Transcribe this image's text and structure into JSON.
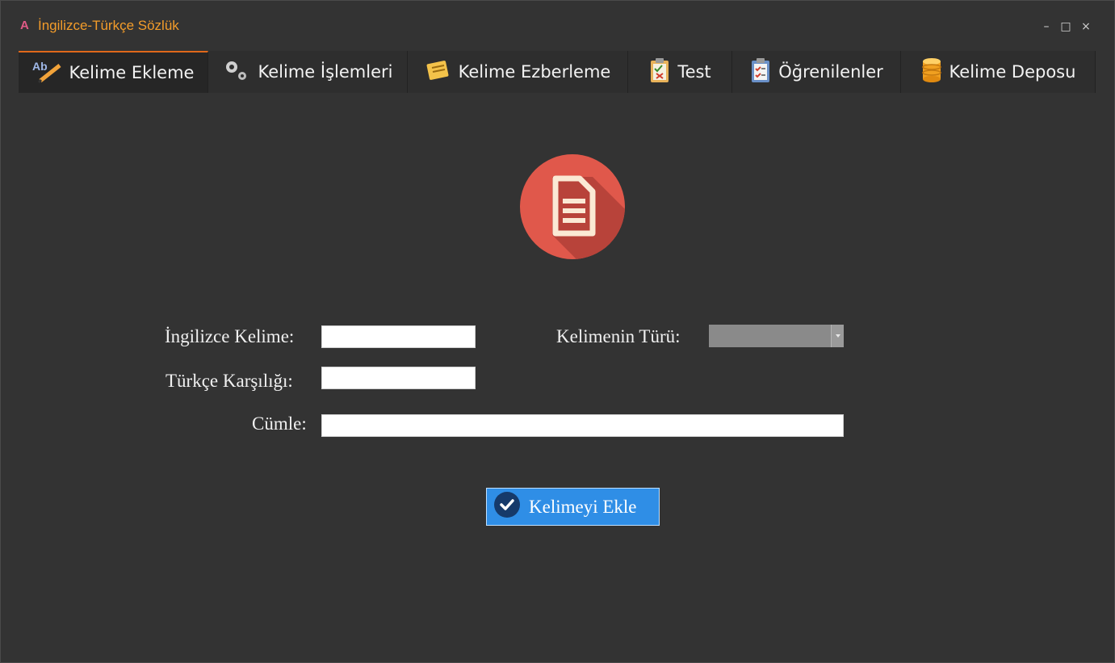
{
  "window": {
    "title": "İngilizce-Türkçe Sözlük",
    "app_icon": "A",
    "controls": {
      "minimize": "–",
      "maximize": "□",
      "close": "×"
    }
  },
  "tabs": [
    {
      "label": "Kelime Ekleme",
      "icon": "ab-pencil-icon",
      "active": true
    },
    {
      "label": "Kelime İşlemleri",
      "icon": "gears-icon",
      "active": false
    },
    {
      "label": "Kelime Ezberleme",
      "icon": "notes-icon",
      "active": false
    },
    {
      "label": "Test",
      "icon": "test-clipboard-icon",
      "active": false
    },
    {
      "label": "Öğrenilenler",
      "icon": "checklist-icon",
      "active": false
    },
    {
      "label": "Kelime Deposu",
      "icon": "database-icon",
      "active": false
    }
  ],
  "form": {
    "english_label": "İngilizce Kelime:",
    "english_value": "",
    "turkish_label": "Türkçe Karşılığı:",
    "turkish_value": "",
    "type_label": "Kelimenin Türü:",
    "type_value": "",
    "sentence_label": "Cümle:",
    "sentence_value": "",
    "submit_label": "Kelimeyi Ekle"
  },
  "colors": {
    "accent": "#e0681a",
    "title": "#f39c2a",
    "button": "#2f8ee6",
    "logo": "#e0584b"
  }
}
